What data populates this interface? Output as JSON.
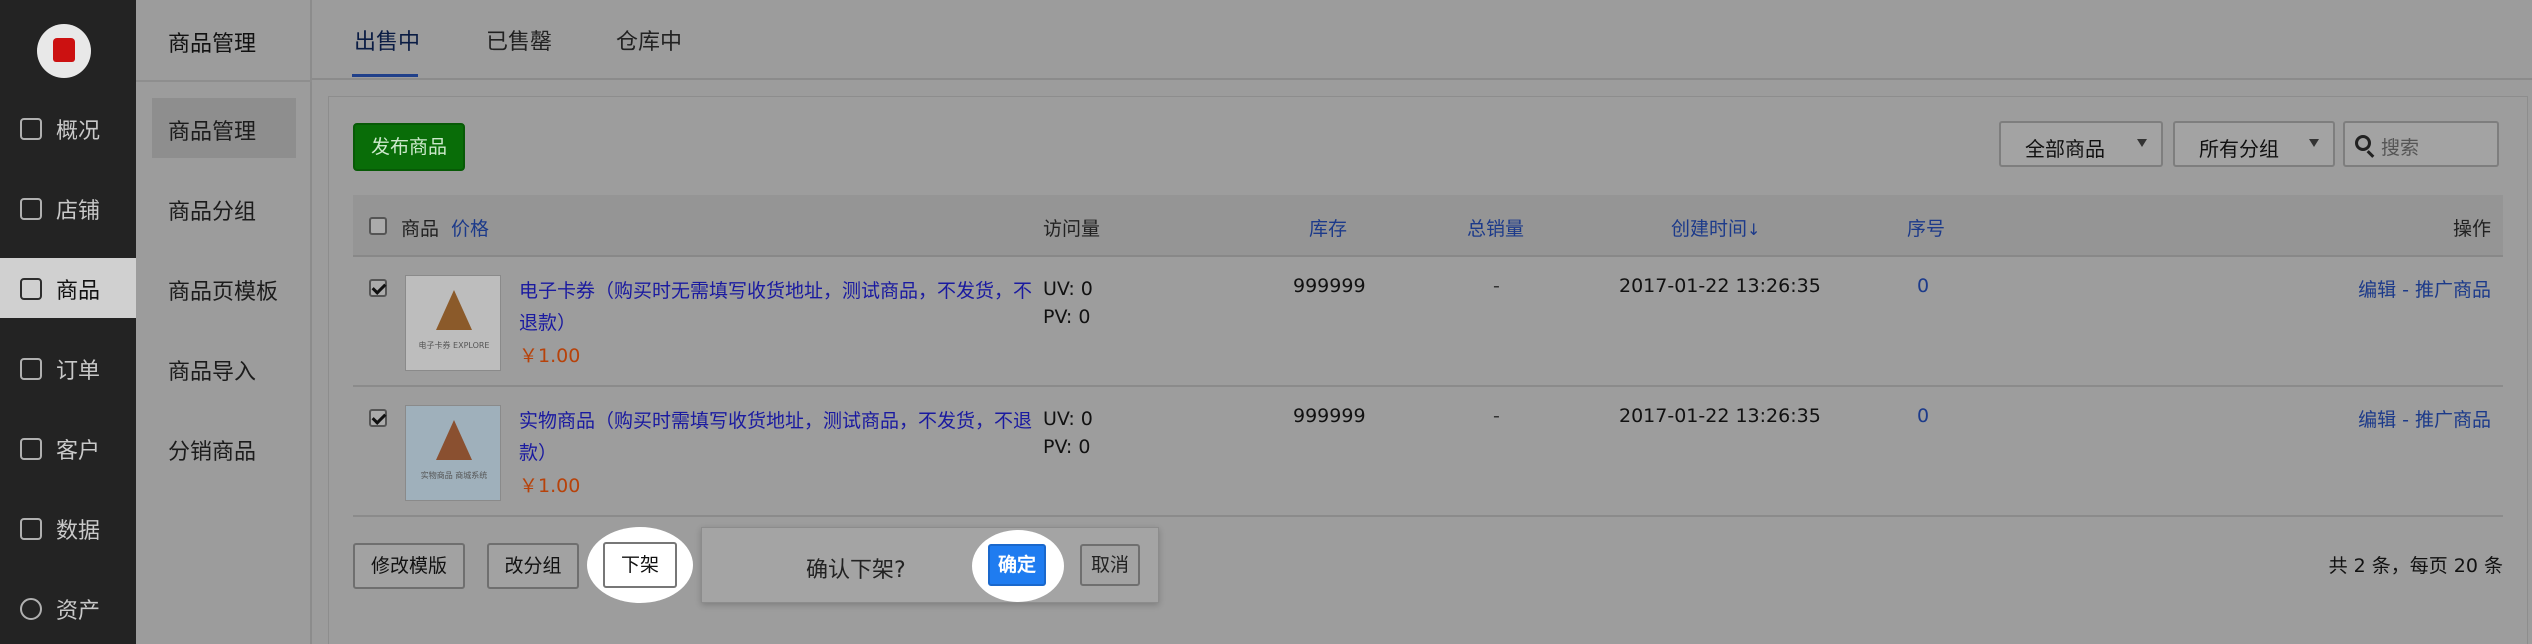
{
  "nav": {
    "items": [
      {
        "label": "概况"
      },
      {
        "label": "店铺"
      },
      {
        "label": "商品"
      },
      {
        "label": "订单"
      },
      {
        "label": "客户"
      },
      {
        "label": "数据"
      },
      {
        "label": "资产"
      }
    ],
    "active_index": 2
  },
  "subnav": {
    "title": "商品管理",
    "items": [
      {
        "label": "商品管理"
      },
      {
        "label": "商品分组"
      },
      {
        "label": "商品页模板"
      },
      {
        "label": "商品导入"
      },
      {
        "label": "分销商品"
      }
    ],
    "active_index": 0
  },
  "tabs": [
    {
      "label": "出售中"
    },
    {
      "label": "已售罄"
    },
    {
      "label": "仓库中"
    }
  ],
  "toolbar": {
    "publish_label": "发布商品",
    "filter_all": "全部商品",
    "filter_group": "所有分组",
    "search_placeholder": "搜索"
  },
  "table": {
    "headers": {
      "product": "商品",
      "price": "价格",
      "visits": "访问量",
      "stock": "库存",
      "sales": "总销量",
      "created": "创建时间",
      "created_arrow": "↓",
      "seq": "序号",
      "ops": "操作"
    },
    "rows": [
      {
        "name": "电子卡券（购买时无需填写收货地址，测试商品，不发货，不退款）",
        "price": "￥1.00",
        "uv": "UV: 0",
        "pv": "PV: 0",
        "stock": "999999",
        "sales": "-",
        "created": "2017-01-22 13:26:35",
        "seq": "0",
        "ops": "编辑 - 推广商品",
        "checked": true,
        "thumb_caption": "电子卡券 EXPLORE",
        "thumb_color": "#bdbdbd"
      },
      {
        "name": "实物商品（购买时需填写收货地址，测试商品，不发货，不退款）",
        "price": "￥1.00",
        "uv": "UV: 0",
        "pv": "PV: 0",
        "stock": "999999",
        "sales": "-",
        "created": "2017-01-22 13:26:35",
        "seq": "0",
        "ops": "编辑 - 推广商品",
        "checked": true,
        "thumb_caption": "实物商品 商城系统",
        "thumb_color": "#9fb0bb"
      }
    ]
  },
  "footer": {
    "edit_template": "修改模版",
    "change_group": "改分组",
    "delist": "下架",
    "total": "共 2 条，每页 20 条"
  },
  "popover": {
    "message": "确认下架?",
    "confirm": "确定",
    "cancel": "取消"
  },
  "colors": {
    "publish_green": "#096d08",
    "confirm_blue": "#1f7cf0",
    "link_blue": "#1c3a8a",
    "price_orange": "#b7420a"
  }
}
